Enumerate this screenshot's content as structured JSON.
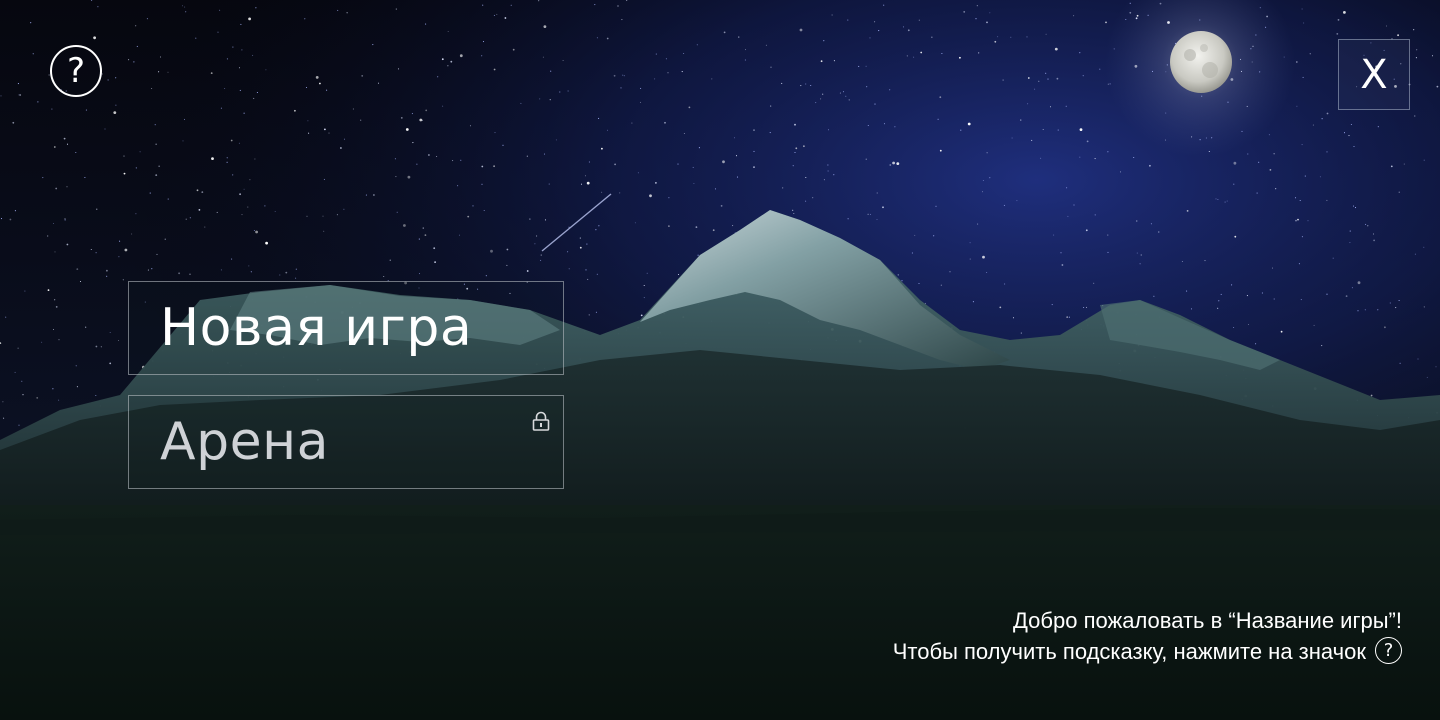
{
  "menu": {
    "new_game_label": "Новая игра",
    "arena_label": "Арена",
    "arena_locked": true
  },
  "controls": {
    "help_symbol": "?",
    "close_symbol": "X",
    "help_icon": "question-circle-icon",
    "close_icon": "close-icon",
    "lock_icon": "lock-icon"
  },
  "welcome": {
    "line1_prefix": "Добро пожаловать в ",
    "game_name": "Название игры",
    "line2": "Чтобы получить подсказку, нажмите на значок",
    "help_symbol": "?"
  },
  "colors": {
    "text": "#ffffff",
    "locked_text": "#cfd2d6",
    "button_border": "#c3c8cd",
    "sky_top": "#04050d",
    "sky_glow": "#1b2a7a",
    "field": "#0a1612"
  }
}
